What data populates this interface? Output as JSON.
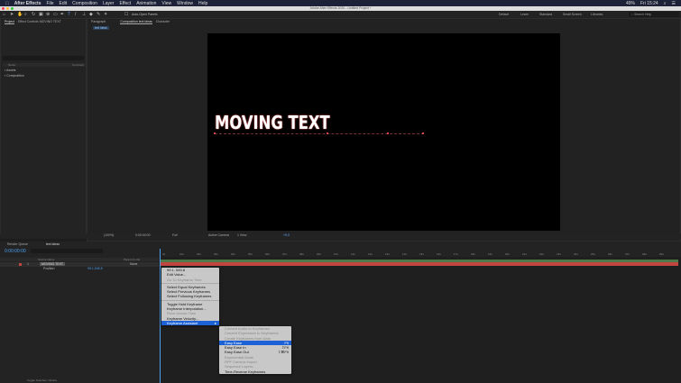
{
  "menubar": {
    "app": "After Effects",
    "items": [
      "File",
      "Edit",
      "Composition",
      "Layer",
      "Effect",
      "Animation",
      "View",
      "Window",
      "Help"
    ],
    "status": {
      "battery": "49%",
      "clock": "Fri 15:24"
    }
  },
  "window_title": "Adobe After Effects 2020 - Untitled Project *",
  "toolbar": {
    "auto_open": "Auto-Open Panels",
    "workspaces": [
      "Default",
      "Learn",
      "Standard",
      "Small Screen",
      "Libraries"
    ],
    "search_placeholder": "Search Help"
  },
  "project_panel": {
    "tabs": [
      "Project",
      "Effect Controls MOVING TEXT"
    ],
    "search_placeholder": "",
    "col_name": "Name",
    "col_type": "Comment",
    "items": [
      "Assets",
      "Composition"
    ]
  },
  "center_tabs": [
    "Paragraph",
    "Composition text ideas",
    "Character"
  ],
  "comp_tab": "text ideas",
  "viewer": {
    "text": "MOVING TEXT",
    "zoom": "(100%)",
    "timecode": "0:00:00:00",
    "resolution": "Full",
    "camera": "Active Camera",
    "views": "1 View",
    "exposure": "+0.0"
  },
  "timeline": {
    "tabs": [
      "Render Queue",
      "text ideas"
    ],
    "timecode": "0:00:00:00",
    "search_placeholder": "",
    "col_source": "Source Name",
    "col_parent": "Parent & Link",
    "layer_name": "MOVING TEXT",
    "layer_num": "1",
    "parent": "None",
    "prop_name": "Position",
    "prop_value": "99.1,545.8",
    "footer": "Toggle Switches / Modes",
    "ruler": [
      "0s",
      "01s",
      "02s",
      "03s",
      "04s",
      "05s",
      "06s",
      "07s",
      "08s",
      "09s",
      "10s",
      "11s",
      "12s",
      "13s",
      "14s",
      "15s",
      "16s",
      "17s",
      "18s",
      "19s",
      "20s",
      "21s",
      "22s",
      "23s",
      "24s",
      "25s",
      "26s",
      "27s",
      "28s",
      "29s"
    ]
  },
  "context_menu": [
    {
      "label": "99.1, 545.8",
      "state": "normal"
    },
    {
      "label": "Edit Value...",
      "state": "normal"
    },
    {
      "label": "Go To Keyframe Time",
      "state": "disabled"
    },
    {
      "label": "Select Equal Keyframes",
      "state": "normal"
    },
    {
      "label": "Select Previous Keyframes",
      "state": "normal"
    },
    {
      "label": "Select Following Keyframes",
      "state": "normal"
    },
    {
      "label": "Toggle Hold Keyframe",
      "state": "normal"
    },
    {
      "label": "Keyframe Interpolation...",
      "state": "normal"
    },
    {
      "label": "Rove Across Time",
      "state": "disabled"
    },
    {
      "label": "Keyframe Velocity...",
      "state": "normal"
    },
    {
      "label": "Keyframe Assistant",
      "state": "selected"
    }
  ],
  "submenu": [
    {
      "label": "Convert Audio to Keyframes",
      "state": "disabled",
      "shortcut": ""
    },
    {
      "label": "Convert Expression to Keyframes",
      "state": "disabled",
      "shortcut": ""
    },
    {
      "label": "Create Keyframes from Data",
      "state": "disabled",
      "shortcut": ""
    },
    {
      "label": "Easy Ease",
      "state": "selected",
      "shortcut": "F9"
    },
    {
      "label": "Easy Ease In",
      "state": "normal",
      "shortcut": "⇧F9"
    },
    {
      "label": "Easy Ease Out",
      "state": "normal",
      "shortcut": "⇧⌘F9"
    },
    {
      "label": "Exponential Scale",
      "state": "disabled",
      "shortcut": ""
    },
    {
      "label": "RPF Camera Import",
      "state": "disabled",
      "shortcut": ""
    },
    {
      "label": "Sequence Layers...",
      "state": "disabled",
      "shortcut": ""
    },
    {
      "label": "Time-Reverse Keyframes",
      "state": "normal",
      "shortcut": ""
    }
  ],
  "colors": {
    "accent": "#1c62d6",
    "layer_bar": "#c0463f",
    "work_area": "#4e7a48"
  }
}
